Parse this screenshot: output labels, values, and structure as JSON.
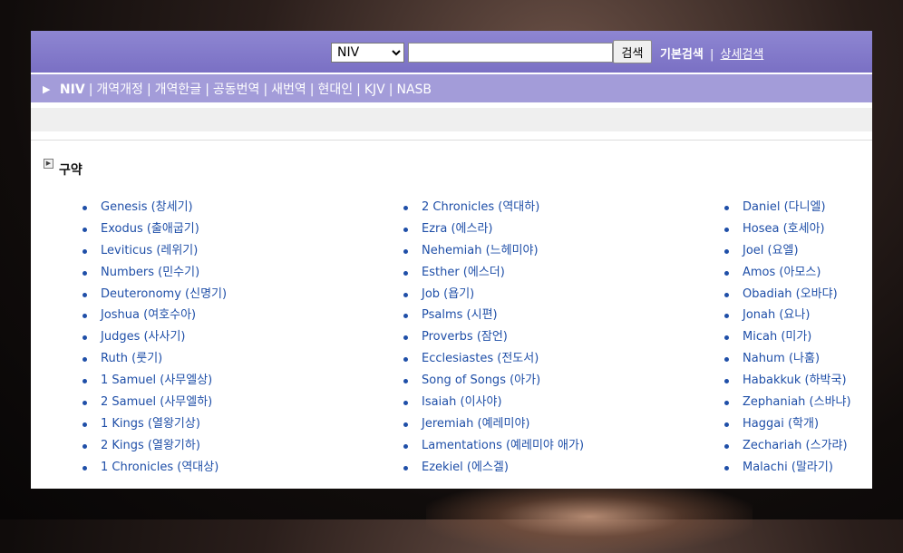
{
  "search": {
    "version_selected": "NIV",
    "input_value": "",
    "button_label": "검색",
    "mode_basic": "기본검색",
    "mode_separator": "|",
    "mode_advanced": "상세검색"
  },
  "nav": {
    "items": [
      "NIV",
      "개역개정",
      "개역한글",
      "공동번역",
      "새번역",
      "현대인",
      "KJV",
      "NASB"
    ],
    "separator": "|"
  },
  "section": {
    "title": "구약"
  },
  "books": {
    "col1": [
      "Genesis (창세기)",
      "Exodus (출애굽기)",
      "Leviticus (레위기)",
      "Numbers (민수기)",
      "Deuteronomy (신명기)",
      "Joshua (여호수아)",
      "Judges (사사기)",
      "Ruth (룻기)",
      "1 Samuel (사무엘상)",
      "2 Samuel (사무엘하)",
      "1 Kings (열왕기상)",
      "2 Kings (열왕기하)",
      "1 Chronicles (역대상)"
    ],
    "col2": [
      "2 Chronicles (역대하)",
      "Ezra (에스라)",
      "Nehemiah (느헤미야)",
      "Esther (에스더)",
      "Job (욥기)",
      "Psalms (시편)",
      "Proverbs (잠언)",
      "Ecclesiastes (전도서)",
      "Song of Songs (아가)",
      "Isaiah (이사야)",
      "Jeremiah (예레미야)",
      "Lamentations (예레미야 애가)",
      "Ezekiel (에스겔)"
    ],
    "col3": [
      "Daniel (다니엘)",
      "Hosea (호세아)",
      "Joel (요엘)",
      "Amos (아모스)",
      "Obadiah (오바댜)",
      "Jonah (요나)",
      "Micah (미가)",
      "Nahum (나훔)",
      "Habakkuk (하박국)",
      "Zephaniah (스바냐)",
      "Haggai (학개)",
      "Zechariah (스가랴)",
      "Malachi (말라기)"
    ]
  },
  "colors": {
    "topbar": "#7a70c4",
    "navbar": "#a39cd9",
    "link": "#1f4fa8"
  }
}
